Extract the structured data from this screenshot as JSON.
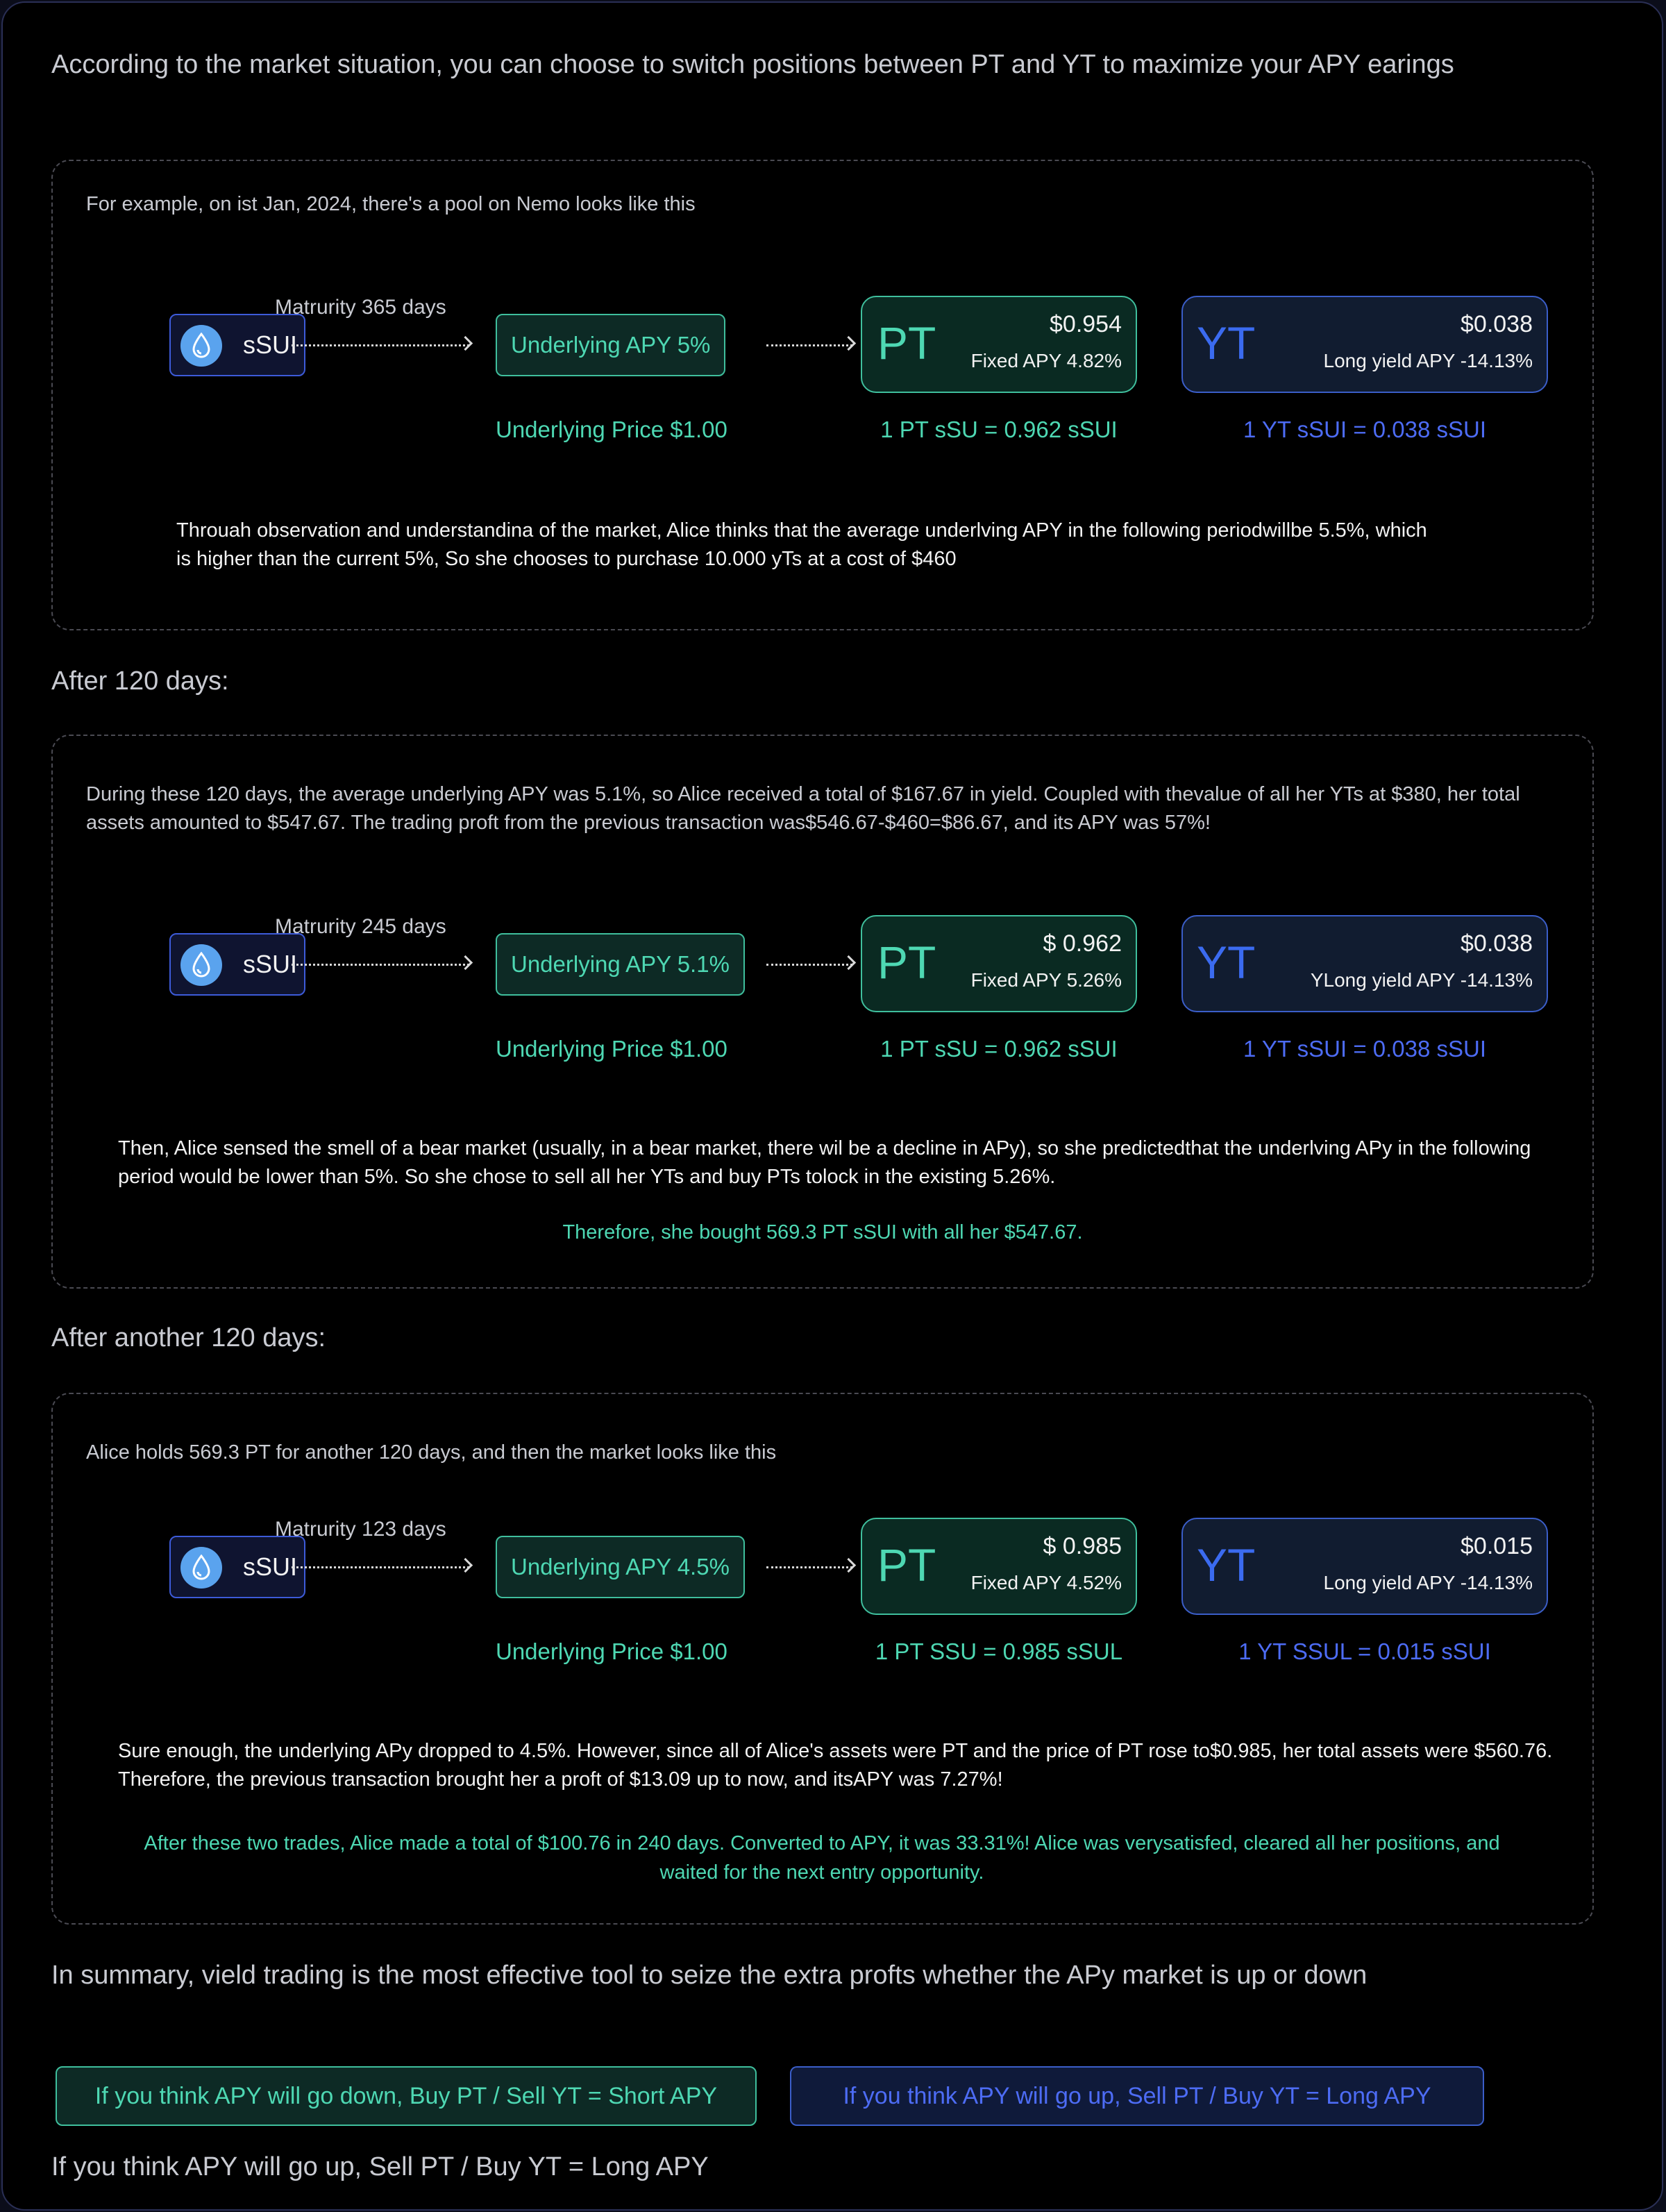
{
  "intro": "According to the market situation, you can choose to switch positions between PT and YT to maximize your APY earings",
  "colors": {
    "green": "#4ed8b3",
    "blue": "#4d6cf5",
    "background": "#000000"
  },
  "icons": {
    "ssui_coin": "water-drop-icon"
  },
  "section1": {
    "lead": "For example, on ist Jan, 2024, there's a pool on Nemo looks like this",
    "market": {
      "token_label": "sSUI",
      "maturity": "Matrurity 365 days",
      "underlying_apy": "Underlying APY 5%",
      "underlying_price": "Underlying Price $1.00",
      "pt": {
        "letter": "PT",
        "price": "$0.954",
        "sub": "Fixed APY 4.82%",
        "conversion": "1 PT sSU = 0.962 sSUI"
      },
      "yt": {
        "letter": "YT",
        "price": "$0.038",
        "sub": "Long yield APY -14.13%",
        "conversion": "1 YT sSUI = 0.038 sSUI"
      }
    },
    "note": "Throuah observation and understandina of the market, Alice thinks that the average underlving APY in the following periodwillbe 5.5%, which is higher than the current 5%, So she chooses to purchase 10.000 yTs at a cost of $460"
  },
  "heading2": "After 120 days:",
  "section2": {
    "lead": "During these 120 days, the average underlying APY was 5.1%, so Alice received a total of $167.67 in yield. Coupled with thevalue of all her YTs at $380, her total assets amounted to $547.67. The trading proft from the previous transaction was$546.67-$460=$86.67, and its APY was 57%!",
    "market": {
      "token_label": "sSUI",
      "maturity": "Matrurity 245 days",
      "underlying_apy": "Underlying APY 5.1%",
      "underlying_price": "Underlying Price $1.00",
      "pt": {
        "letter": "PT",
        "price": "$ 0.962",
        "sub": "Fixed APY 5.26%",
        "conversion": "1 PT sSU = 0.962 sSUI"
      },
      "yt": {
        "letter": "YT",
        "price": "$0.038",
        "sub": "YLong yield APY -14.13%",
        "conversion": "1 YT sSUI = 0.038 sSUI"
      }
    },
    "note": "Then, Alice sensed the smell of a bear market (usually, in a bear market, there wil be a decline in APy), so she predictedthat the underlving APy in the following period would be lower than 5%. So she chose to sell all her YTs and buy PTs tolock in the existing 5.26%.",
    "highlight": "Therefore, she bought 569.3 PT sSUI with all her $547.67."
  },
  "heading3": "After another 120 days:",
  "section3": {
    "lead": "Alice holds 569.3 PT for another 120 days, and then the market looks like this",
    "market": {
      "token_label": "sSUI",
      "maturity": "Matrurity 123 days",
      "underlying_apy": "Underlying APY 4.5%",
      "underlying_price": "Underlying Price $1.00",
      "pt": {
        "letter": "PT",
        "price": "$ 0.985",
        "sub": "Fixed APY 4.52%",
        "conversion": "1 PT SSU = 0.985 sSUL"
      },
      "yt": {
        "letter": "YT",
        "price": "$0.015",
        "sub": "Long yield APY -14.13%",
        "conversion": "1 YT SSUL = 0.015 sSUI"
      }
    },
    "note": "Sure enough, the underlying APy dropped to 4.5%. However, since all of Alice's assets were PT and the price of PT rose to$0.985, her total assets were $560.76. Therefore, the previous transaction brought her a proft of $13.09 up to now, and itsAPY was 7.27%!",
    "highlight": "After these two trades, Alice made a total of $100.76 in 240 days. Converted to APY, it was 33.31%! Alice was verysatisfed, cleared all her positions, and waited for the next entry opportunity."
  },
  "summary": "In summary, vield trading is the most effective tool to seize the extra profts whether the APy market is up or down",
  "buttons": {
    "short": "If you think APY will go down, Buy PT / Sell YT = Short APY",
    "long": "If you think APY will go up, Sell PT / Buy YT = Long APY"
  },
  "footer": "If you think APY will go up, Sell PT / Buy YT = Long APY"
}
